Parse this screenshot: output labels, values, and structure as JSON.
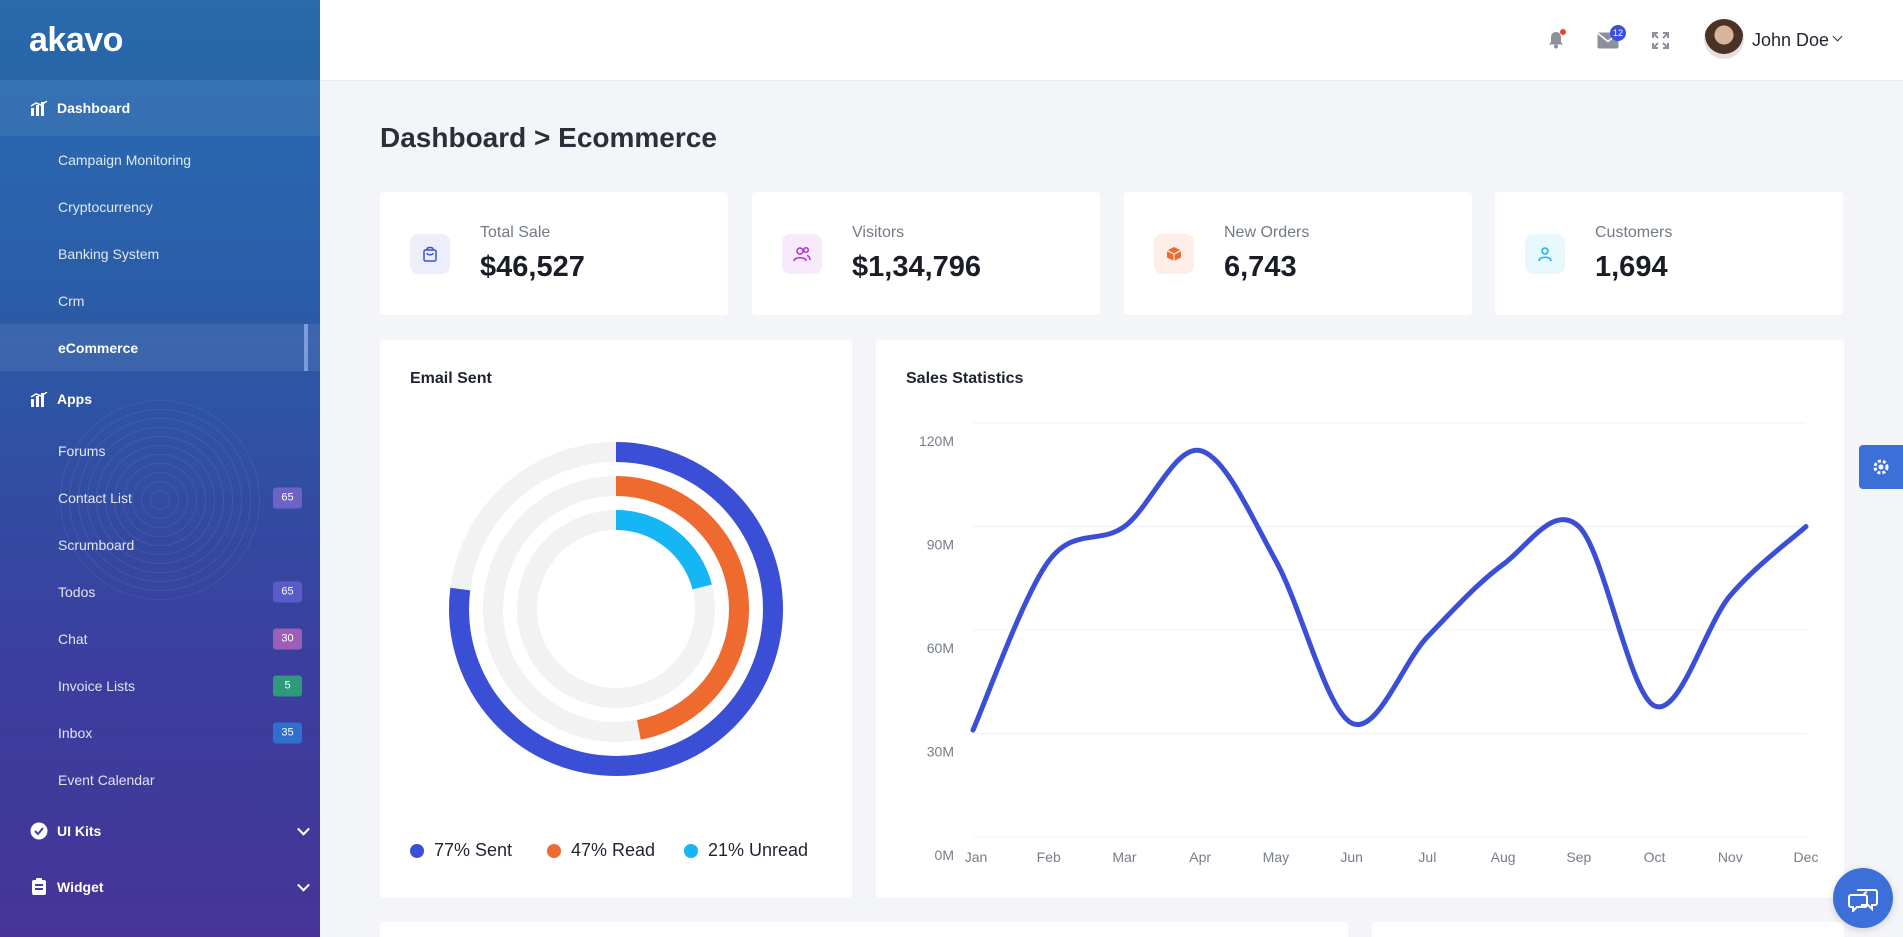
{
  "brand": {
    "logo": "akavo"
  },
  "sidebar": {
    "dashboard": {
      "label": "Dashboard",
      "items": [
        "Campaign Monitoring",
        "Cryptocurrency",
        "Banking System",
        "Crm",
        "eCommerce"
      ]
    },
    "apps": {
      "label": "Apps",
      "items": [
        {
          "label": "Forums"
        },
        {
          "label": "Contact List",
          "badge": "65",
          "badge_color": "#6e62c9"
        },
        {
          "label": "Scrumboard"
        },
        {
          "label": "Todos",
          "badge": "65",
          "badge_color": "#5a5ac8"
        },
        {
          "label": "Chat",
          "badge": "30",
          "badge_color": "#9b5fb8"
        },
        {
          "label": "Invoice Lists",
          "badge": "5",
          "badge_color": "#2f9a7a"
        },
        {
          "label": "Inbox",
          "badge": "35",
          "badge_color": "#2f6fd0"
        },
        {
          "label": "Event Calendar"
        }
      ]
    },
    "ui_kits": {
      "label": "UI Kits"
    },
    "widget": {
      "label": "Widget"
    }
  },
  "header": {
    "mail_count": "12",
    "user_name": "John Doe"
  },
  "page": {
    "title": "Dashboard > Ecommerce"
  },
  "stats": [
    {
      "label": "Total Sale",
      "value": "$46,527",
      "icon": "shopping-bag-icon",
      "color": "#3c50d8",
      "bg": "#eceefb"
    },
    {
      "label": "Visitors",
      "value": "$1,34,796",
      "icon": "users-icon",
      "color": "#b22fcf",
      "bg": "#f8eafc"
    },
    {
      "label": "New Orders",
      "value": "6,743",
      "icon": "box-icon",
      "color": "#ee6a2e",
      "bg": "#fdefe8"
    },
    {
      "label": "Customers",
      "value": "1,694",
      "icon": "user-icon",
      "color": "#1fb5e8",
      "bg": "#e8f8fd"
    }
  ],
  "email_card": {
    "title": "Email Sent",
    "legend": [
      {
        "label": "77% Sent",
        "color": "#3b4fd6"
      },
      {
        "label": "47% Read",
        "color": "#ee6a2e"
      },
      {
        "label": "21% Unread",
        "color": "#14b6f3"
      }
    ]
  },
  "sales_card": {
    "title": "Sales Statistics"
  },
  "chart_data": [
    {
      "type": "radialBar",
      "title": "Email Sent",
      "categories": [
        "Sent",
        "Read",
        "Unread"
      ],
      "values": [
        77,
        47,
        21
      ],
      "unit": "%",
      "colors": [
        "#3b4fd6",
        "#ee6a2e",
        "#14b6f3"
      ],
      "legend_position": "bottom"
    },
    {
      "type": "line",
      "title": "Sales Statistics",
      "categories": [
        "Jan",
        "Feb",
        "Mar",
        "Apr",
        "May",
        "Jun",
        "Jul",
        "Aug",
        "Sep",
        "Oct",
        "Nov",
        "Dec"
      ],
      "series": [
        {
          "values": [
            31,
            80,
            90,
            112,
            80,
            33,
            58,
            79,
            90,
            38,
            70,
            90
          ],
          "color": "#3b4fd6"
        }
      ],
      "ylim": [
        0,
        120
      ],
      "yticks": [
        "0M",
        "30M",
        "60M",
        "90M",
        "120M"
      ],
      "grid": true
    }
  ]
}
